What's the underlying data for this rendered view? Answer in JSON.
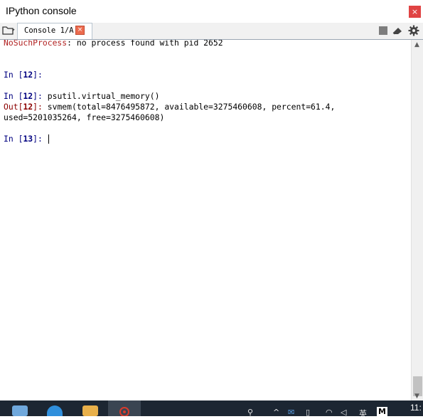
{
  "window": {
    "title": "IPython console",
    "close_glyph": "×"
  },
  "tabs": [
    {
      "label": "Console 1/A",
      "close_glyph": "×"
    }
  ],
  "console": {
    "lines": {
      "error_type": "NoSuchProcess",
      "error_msg": ": no process found with pid 2652",
      "in_prefix": "In [",
      "in_suffix": "]: ",
      "out_prefix": "Out[",
      "out_suffix": "]: ",
      "prompt12": "12",
      "prompt13": "13",
      "cmd12": "psutil.virtual_memory()",
      "out12_line1": "svmem(total=8476495872, available=3275460608, percent=61.4,",
      "out12_line2": "used=5201035264, free=3275460608)"
    }
  },
  "taskbar": {
    "tray_ime": "英",
    "clock": "11:"
  },
  "colors": {
    "error": "#b22222",
    "prompt_in": "#000080",
    "prompt_out": "#8b0000",
    "taskbar_bg": "#1c2632"
  }
}
